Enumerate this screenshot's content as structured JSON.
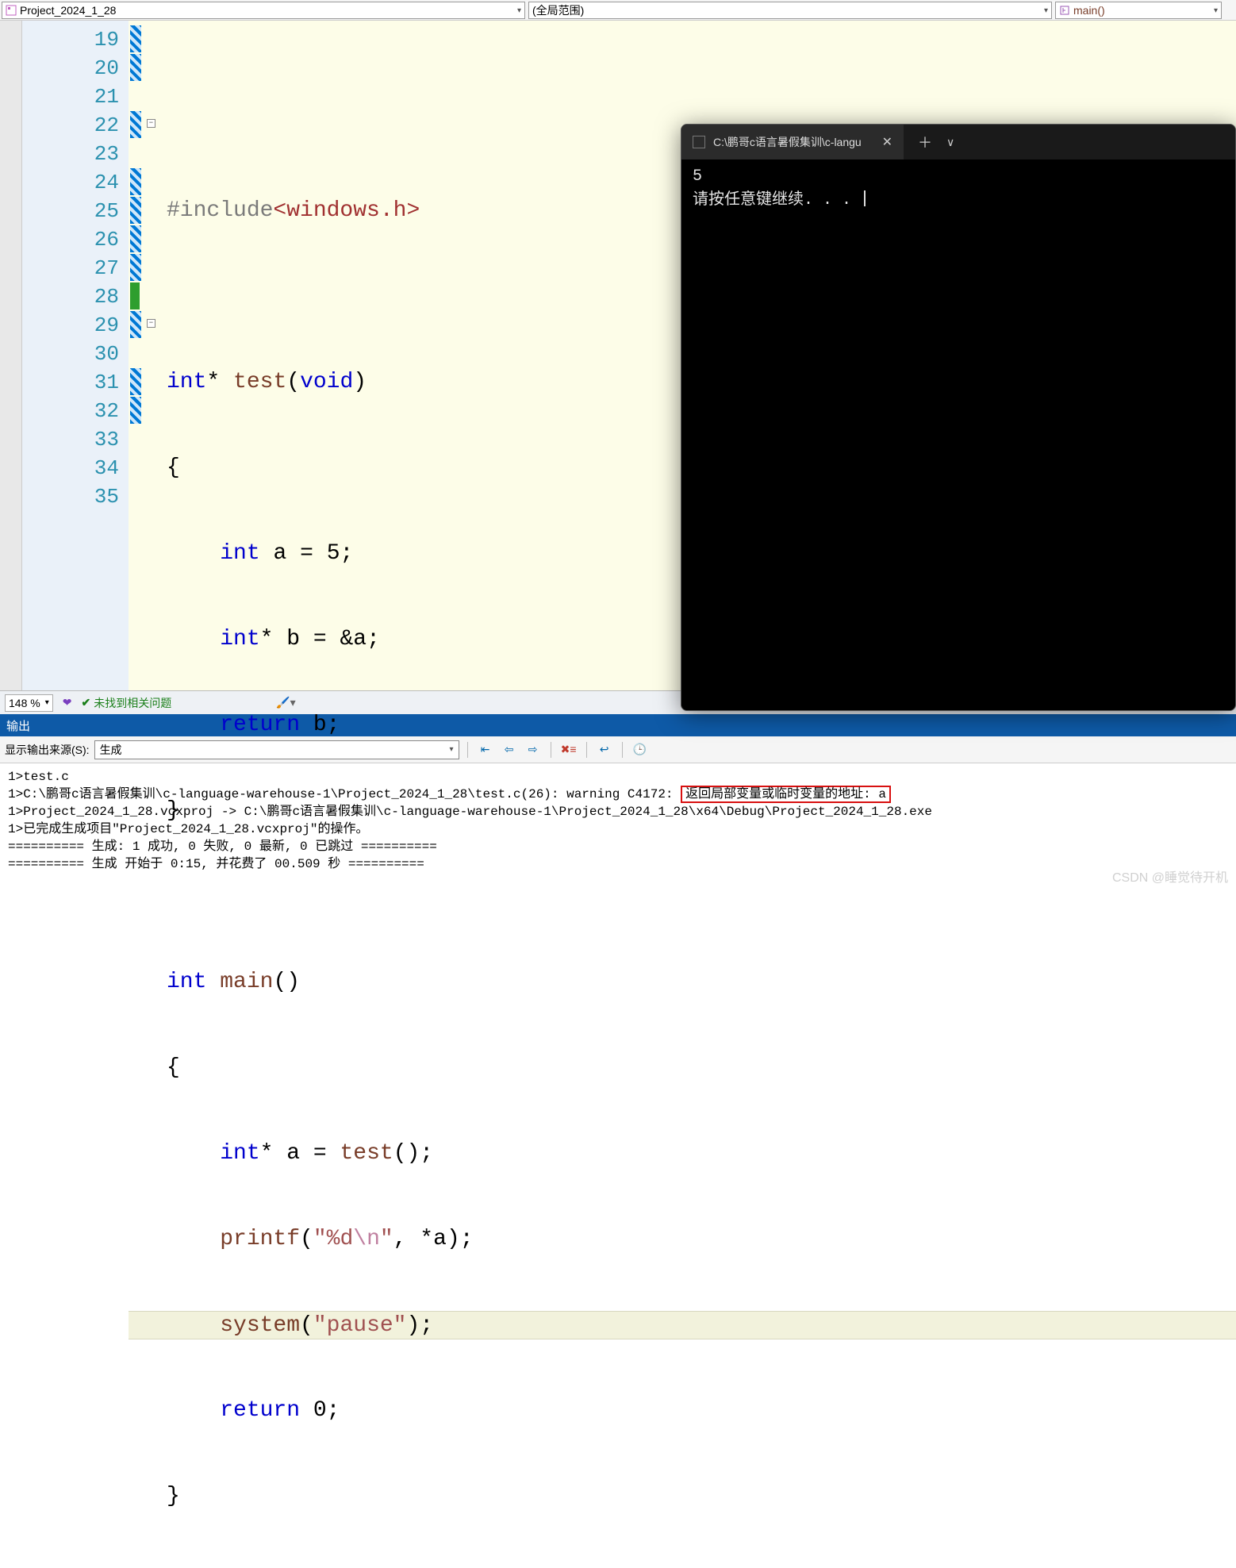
{
  "top": {
    "project": "Project_2024_1_28",
    "scope": "(全局范围)",
    "func": "main()"
  },
  "code": {
    "lines": [
      19,
      20,
      21,
      22,
      23,
      24,
      25,
      26,
      27,
      28,
      29,
      30,
      31,
      32,
      33,
      34,
      35
    ],
    "current_line": 33,
    "strip_lines": [
      19,
      20,
      22,
      24,
      25,
      26,
      27,
      29,
      31,
      32
    ],
    "green_lines": [
      28
    ],
    "fold_points": [
      22,
      29
    ],
    "include_pp": "#include",
    "include_hdr": "<windows.h>",
    "kw_int": "int",
    "kw_void": "void",
    "kw_return": "return",
    "id_test": "test",
    "id_main": "main",
    "id_printf": "printf",
    "id_system": "system",
    "var_a": "a",
    "var_b": "b",
    "lit_5": "5",
    "lit_0": "0",
    "str_fmt_prefix": "\"%d",
    "str_esc": "\\n",
    "str_fmt_suffix": "\"",
    "str_pause": "\"pause\""
  },
  "status": {
    "zoom": "148 %",
    "no_issues": "未找到相关问题"
  },
  "output": {
    "panel_title": "输出",
    "from_label": "显示输出来源(S):",
    "source": "生成",
    "lines": {
      "l1": "1>test.c",
      "l2": "1>C:\\鹏哥c语言暑假集训\\c-language-warehouse-1\\Project_2024_1_28\\test.c(26): warning C4172: ",
      "warn": "返回局部变量或临时变量的地址: a",
      "l3": "1>Project_2024_1_28.vcxproj -> C:\\鹏哥c语言暑假集训\\c-language-warehouse-1\\Project_2024_1_28\\x64\\Debug\\Project_2024_1_28.exe",
      "l4": "1>已完成生成项目\"Project_2024_1_28.vcxproj\"的操作。",
      "l5": "========== 生成: 1 成功, 0 失败, 0 最新, 0 已跳过 ==========",
      "l6": "========== 生成 开始于 0:15, 并花费了 00.509 秒 =========="
    }
  },
  "console": {
    "title": "C:\\鹏哥c语言暑假集训\\c-langu",
    "line1": "5",
    "line2": "请按任意键继续. . . "
  },
  "watermark": "CSDN @睡觉待开机"
}
